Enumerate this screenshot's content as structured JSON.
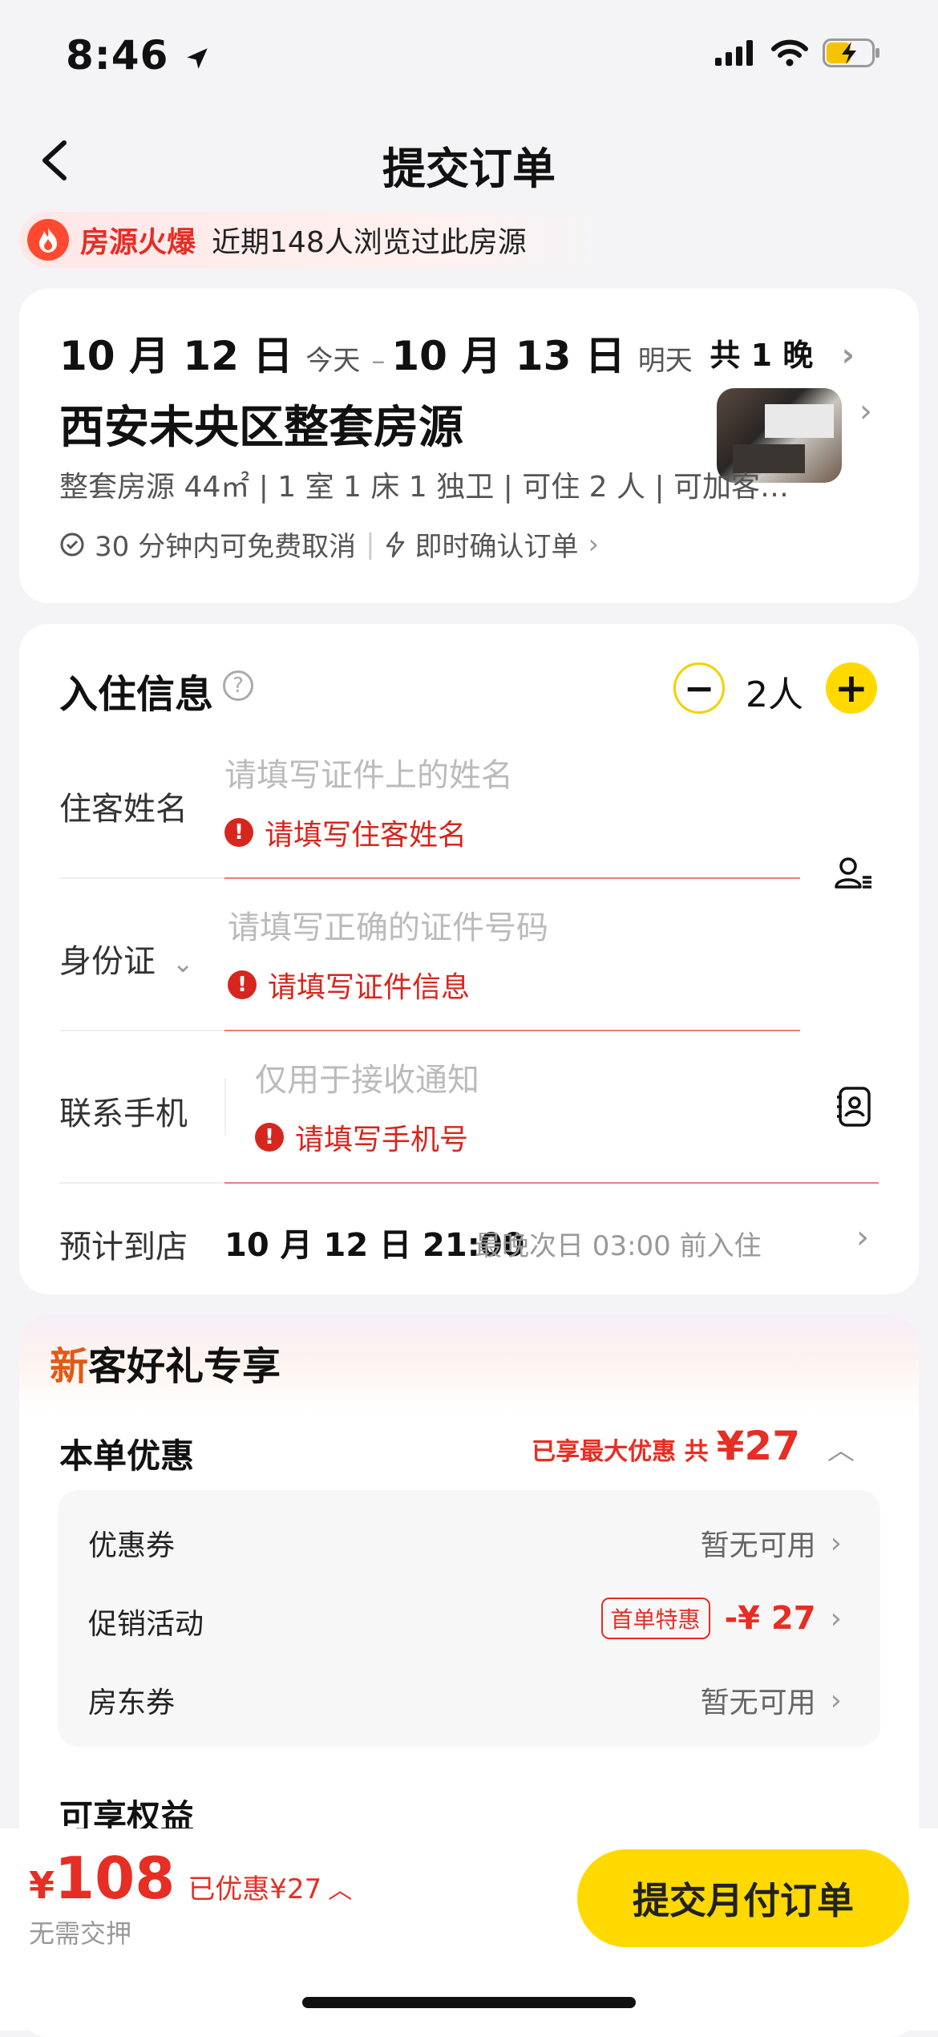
{
  "status_bar": {
    "time": "8:46"
  },
  "header": {
    "title": "提交订单"
  },
  "hot_banner": {
    "tag": "房源火爆",
    "text": "近期148人浏览过此房源"
  },
  "stay": {
    "checkin": "10 月 12 日",
    "checkin_tag": "今天",
    "separator": "–",
    "checkout": "10 月 13 日",
    "checkout_tag": "明天",
    "nights": "共 1 晚",
    "title": "西安未央区整套房源",
    "specs": "整套房源 44㎡ | 1 室 1 床 1 独卫 | 可住 2 人 | 可加客…",
    "policy_cancel": "30 分钟内可免费取消",
    "policy_confirm": "即时确认订单"
  },
  "checkin_info": {
    "title": "入住信息",
    "guest_count": "2人",
    "name_field": {
      "label": "住客姓名",
      "placeholder": "请填写证件上的姓名",
      "error": "请填写住客姓名"
    },
    "id_field": {
      "label": "身份证",
      "placeholder": "请填写正确的证件号码",
      "error": "请填写证件信息"
    },
    "phone_field": {
      "label": "联系手机",
      "placeholder": "仅用于接收通知",
      "error": "请填写手机号"
    },
    "arrival": {
      "label": "预计到店",
      "value": "10 月 12 日 21:00",
      "note": "最晚次日 03:00 前入住"
    }
  },
  "offers": {
    "banner": "客好礼专享",
    "banner_prefix": "新",
    "title": "本单优惠",
    "summary_label": "已享最大优惠 共",
    "summary_amount": "¥27",
    "rows": [
      {
        "label": "优惠券",
        "value": "暂无可用"
      },
      {
        "label": "促销活动",
        "badge": "首单特惠",
        "value": "-¥ 27"
      },
      {
        "label": "房东券",
        "value": "暂无可用"
      }
    ],
    "rights_title": "可享权益"
  },
  "footer": {
    "currency": "¥",
    "price": "108",
    "saved": "已优惠¥27",
    "deposit": "无需交押",
    "submit": "提交月付订单"
  },
  "colors": {
    "accent": "#ffd900",
    "error": "#d7261e",
    "price": "#e62e24"
  }
}
